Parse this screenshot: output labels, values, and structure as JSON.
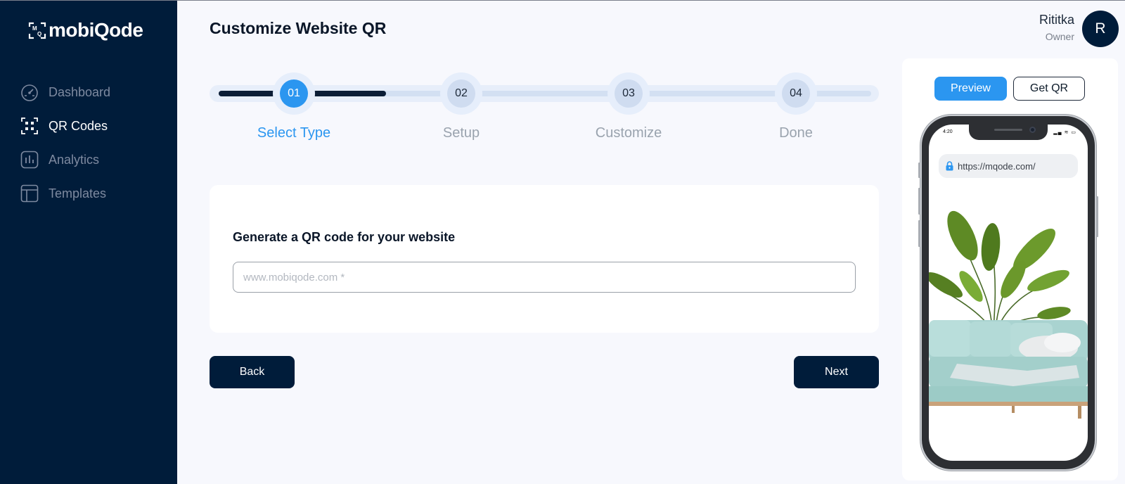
{
  "app": {
    "brand": "mobiQode"
  },
  "sidebar": {
    "items": [
      {
        "label": "Dashboard",
        "icon": "speedometer-icon",
        "active": false
      },
      {
        "label": "QR Codes",
        "icon": "qr-code-icon",
        "active": true
      },
      {
        "label": "Analytics",
        "icon": "bar-chart-icon",
        "active": false
      },
      {
        "label": "Templates",
        "icon": "template-layout-icon",
        "active": false
      }
    ]
  },
  "header": {
    "title": "Customize Website QR",
    "user": {
      "name": "Rititka",
      "role": "Owner",
      "initial": "R"
    }
  },
  "stepper": {
    "current": 1,
    "steps": [
      {
        "number": "01",
        "label": "Select Type"
      },
      {
        "number": "02",
        "label": "Setup"
      },
      {
        "number": "03",
        "label": "Customize"
      },
      {
        "number": "04",
        "label": "Done"
      }
    ]
  },
  "form": {
    "title": "Generate a QR code for your website",
    "url_placeholder": "www.mobiqode.com *",
    "url_value": ""
  },
  "actions": {
    "back_label": "Back",
    "next_label": "Next"
  },
  "preview": {
    "preview_label": "Preview",
    "get_qr_label": "Get QR",
    "phone": {
      "time": "4:20",
      "url": "https://mqode.com/"
    }
  },
  "colors": {
    "sidebar": "#001c3a",
    "accent": "#2b96f0",
    "page_bg": "#f7f8fd",
    "button_dark": "#001c3a"
  }
}
